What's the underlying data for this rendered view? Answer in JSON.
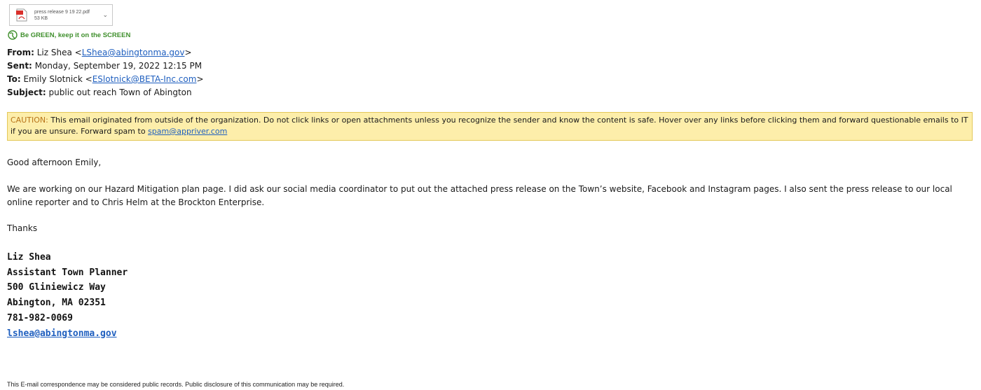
{
  "attachment": {
    "filename": "press release 9 19 22.pdf",
    "size": "53 KB",
    "icon": "pdf-icon",
    "dropdown_icon": "chevron-down-icon"
  },
  "green_banner": {
    "icon": "globe-icon",
    "text": "Be GREEN, keep it on the SCREEN"
  },
  "headers": {
    "from_label": "From:",
    "from_name": "Liz Shea <",
    "from_email": "LShea@abingtonma.gov",
    "from_close": ">",
    "sent_label": "Sent:",
    "sent_value": "Monday, September 19, 2022 12:15 PM",
    "to_label": "To:",
    "to_name": "Emily Slotnick <",
    "to_email": "ESlotnick@BETA-Inc.com",
    "to_close": ">",
    "subject_label": "Subject:",
    "subject_value": "public out reach Town of Abington"
  },
  "caution": {
    "prefix": "CAUTION:",
    "text": " This email originated from outside of the organization. Do not click links or open attachments unless you recognize the sender and know the content is safe. Hover over any links before clicking them and forward questionable emails to IT if you are unsure. Forward spam to ",
    "spam_email": "spam@appriver.com"
  },
  "body": {
    "greeting": "Good afternoon Emily,",
    "paragraph": "We are working on our Hazard Mitigation plan page.  I did ask our social media coordinator to put out the attached press release on the Town’s website, Facebook and Instagram pages.  I also sent the press release to our local online reporter and to Chris Helm at the Brockton Enterprise.",
    "thanks": "Thanks"
  },
  "signature": {
    "name": "Liz Shea",
    "title": "Assistant Town Planner",
    "street": "500 Gliniewicz Way",
    "city": "Abington, MA 02351",
    "phone": "781-982-0069",
    "email": "lshea@abingtonma.gov"
  },
  "footer": {
    "text": "This E-mail correspondence may be considered public records. Public disclosure of this communication may be required."
  },
  "colors": {
    "link": "#1f5fbf",
    "caution_bg": "#fdeeaa",
    "caution_prefix": "#b8741a",
    "green_banner": "#3f8f2c"
  }
}
